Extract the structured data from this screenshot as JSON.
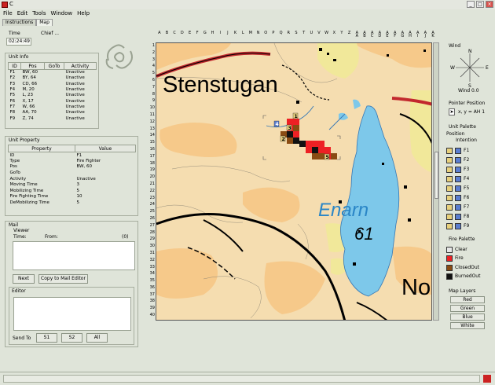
{
  "window": {
    "title": "C"
  },
  "menu": [
    "File",
    "Edit",
    "Tools",
    "Window",
    "Help"
  ],
  "tabs": [
    "Instructions",
    "Map"
  ],
  "time": {
    "label": "Time",
    "value": "02:24:49",
    "chief_label": "Chief ..."
  },
  "unit_info": {
    "title": "Unit Info",
    "headers": [
      "ID",
      "Pos",
      "GoTo",
      "Activity"
    ],
    "rows": [
      [
        "F1",
        "BW, 60",
        "",
        "Unactive"
      ],
      [
        "F2",
        "BY, 64",
        "",
        "Unactive"
      ],
      [
        "F3",
        "CD, 66",
        "",
        "Unactive"
      ],
      [
        "F4",
        "M, 20",
        "",
        "Unactive"
      ],
      [
        "F5",
        "L, 23",
        "",
        "Unactive"
      ],
      [
        "F6",
        "X, 17",
        "",
        "Unactive"
      ],
      [
        "F7",
        "W, 66",
        "",
        "Unactive"
      ],
      [
        "F8",
        "AA, 70",
        "",
        "Unactive"
      ],
      [
        "F9",
        "Z, 74",
        "",
        "Unactive"
      ]
    ]
  },
  "unit_property": {
    "title": "Unit Property",
    "headers": [
      "Property",
      "Value"
    ],
    "rows": [
      [
        "ID",
        "F1"
      ],
      [
        "Type",
        "Fire Fighter"
      ],
      [
        "Pos",
        "BW, 60"
      ],
      [
        "GoTo",
        ""
      ],
      [
        "Activity",
        "Unactive"
      ],
      [
        "Moving Time",
        "3"
      ],
      [
        "Mobilizing Time",
        "5"
      ],
      [
        "Fire Fighting Time",
        "10"
      ],
      [
        "DeMobilizing Time",
        "5"
      ]
    ]
  },
  "mail": {
    "title": "Mail",
    "viewer_label": "Viewer",
    "time_label": "Time:",
    "from_label": "From:",
    "count": "(0)",
    "next_button": "Next",
    "copy_button": "Copy to Mail Editor",
    "editor_label": "Editor",
    "send_to_label": "Send To",
    "send_buttons": [
      "S1",
      "S2",
      "All"
    ]
  },
  "map": {
    "columns": [
      "A",
      "B",
      "C",
      "D",
      "E",
      "F",
      "G",
      "H",
      "I",
      "J",
      "K",
      "L",
      "M",
      "N",
      "O",
      "P",
      "Q",
      "R",
      "S",
      "T",
      "U",
      "V",
      "W",
      "X",
      "Y",
      "Z",
      "A\nA",
      "A\nB",
      "A\nC",
      "A\nD",
      "A\nE",
      "A\nF",
      "A\nG",
      "A\nH",
      "A\nI",
      "A\nJ",
      "A\nK"
    ],
    "rows": [
      "1",
      "2",
      "3",
      "4",
      "5",
      "6",
      "7",
      "8",
      "9",
      "10",
      "11",
      "12",
      "13",
      "14",
      "15",
      "16",
      "17",
      "18",
      "19",
      "20",
      "21",
      "22",
      "23",
      "24",
      "25",
      "26",
      "27",
      "28",
      "29",
      "30",
      "31",
      "32",
      "33",
      "34",
      "35",
      "36",
      "37",
      "38",
      "39",
      "40"
    ],
    "place_names": {
      "stenstugan": "Stenstugan",
      "enarn": "Enarn",
      "num61": "61",
      "no": "No"
    },
    "unit_markers": [
      "1",
      "2",
      "3",
      "4",
      "5",
      "6",
      "7",
      "8",
      "9"
    ],
    "colors": {
      "land": "#f5ddb0",
      "forest": "#f6c98a",
      "water": "#7dc8ea",
      "field": "#f1e89a",
      "fire": "#ed2024",
      "closed": "#8a4b12",
      "burned": "#111111",
      "road": "#000000",
      "red_road": "#c2282e"
    }
  },
  "wind": {
    "title": "Wind",
    "directions": [
      "N",
      "W",
      "E",
      "S"
    ],
    "value": "Wind 0.0"
  },
  "pointer": {
    "title": "Pointer Position",
    "value": "x, y = AH 1"
  },
  "unit_palette": {
    "title": "Unit Palette",
    "position_label": "Position",
    "intention_label": "Intention",
    "units": [
      "F1",
      "F2",
      "F3",
      "F4",
      "F5",
      "F6",
      "F7",
      "F8",
      "F9"
    ]
  },
  "fire_palette": {
    "title": "Fire Palette",
    "items": [
      {
        "label": "Clear",
        "color": "#e6e6e6"
      },
      {
        "label": "Fire",
        "color": "#ed2024"
      },
      {
        "label": "ClosedOut",
        "color": "#8a4b12"
      },
      {
        "label": "BurnedOut",
        "color": "#111111"
      }
    ]
  },
  "map_layers": {
    "title": "Map Layers",
    "buttons": [
      "Red",
      "Green",
      "Blue",
      "White"
    ]
  }
}
